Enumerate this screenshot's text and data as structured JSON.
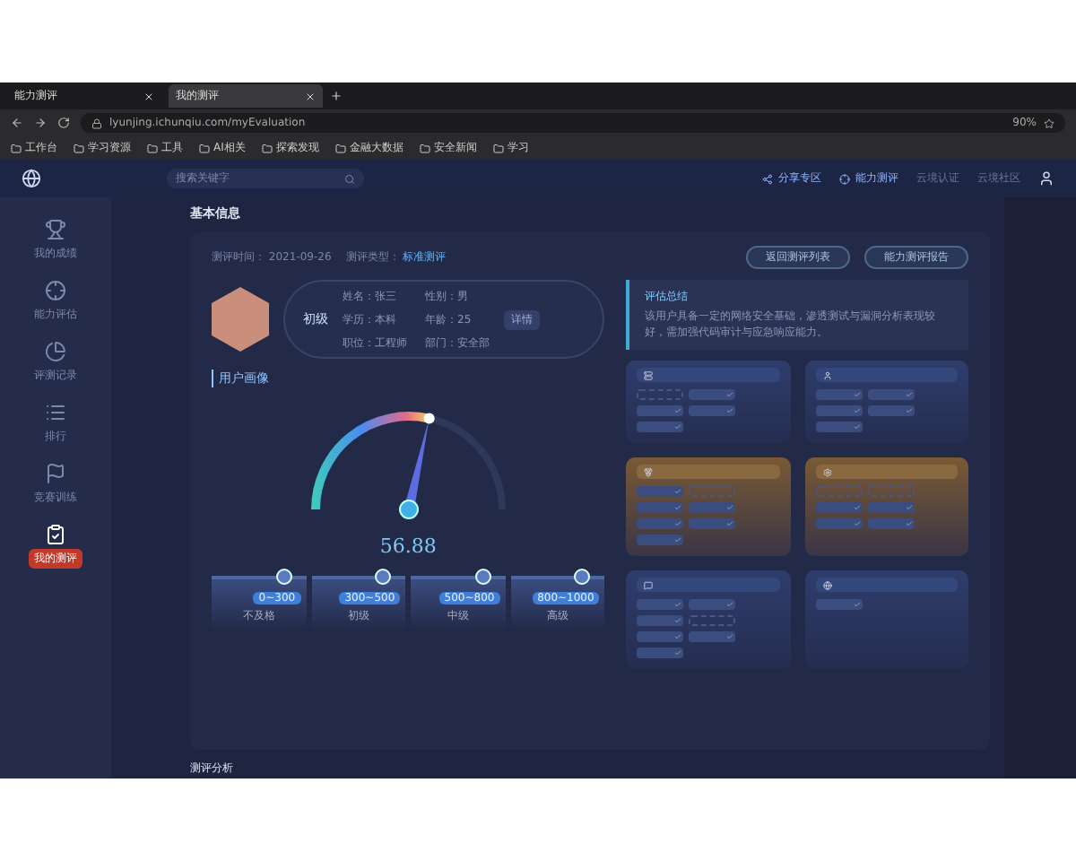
{
  "browser": {
    "tabs": [
      {
        "label": "能力测评",
        "selected": false
      },
      {
        "label": "我的测评",
        "selected": true
      }
    ],
    "url": "lyunjing.ichunqiu.com/myEvaluation",
    "zoom": "90%",
    "bookmarks": [
      "工作台",
      "学习资源",
      "工具",
      "AI相关",
      "探索发现",
      "金融大数据",
      "安全新闻",
      "学习"
    ]
  },
  "header": {
    "search": {
      "placeholder": "搜索关键字"
    },
    "actions": [
      "分享专区",
      "能力测评"
    ],
    "links": [
      "云境认证",
      "云境社区"
    ]
  },
  "sidebar": {
    "items": [
      {
        "label": "我的成绩",
        "selected": false
      },
      {
        "label": "能力评估",
        "selected": false
      },
      {
        "label": "评测记录",
        "selected": false
      },
      {
        "label": "排行",
        "selected": false
      },
      {
        "label": "竞赛训练",
        "selected": false
      },
      {
        "label": "我的测评",
        "selected": true
      }
    ]
  },
  "page": {
    "title": "基本信息",
    "date_label": "测评时间：",
    "date": "2021-09-26",
    "type_label": "测评类型：",
    "type": "标准测评",
    "buttons": [
      "返回测评列表",
      "能力测评报告"
    ],
    "profile": {
      "level": "初级",
      "fields": [
        "姓名：张三",
        "性别：男",
        "学历：本科",
        "年龄：25",
        "职位：工程师",
        "部门：安全部"
      ],
      "tag": "详情"
    },
    "summary": {
      "title": "评估总结",
      "text": "该用户具备一定的网络安全基础，渗透测试与漏洞分析表现较好，需加强代码审计与应急响应能力。"
    },
    "portrait": {
      "title": "用户画像",
      "score": "56.88",
      "level": 0.57,
      "bands": [
        {
          "range": "0~300",
          "label": "不及格"
        },
        {
          "range": "300~500",
          "label": "初级"
        },
        {
          "range": "500~800",
          "label": "中级"
        },
        {
          "range": "800~1000",
          "label": "高级"
        }
      ]
    },
    "cards": [
      {
        "kind": "blue",
        "chips": [
          {
            "checked": false
          },
          {
            "checked": true
          },
          {
            "checked": true
          },
          {
            "checked": true
          },
          {
            "checked": true
          }
        ]
      },
      {
        "kind": "blue",
        "chips": [
          {
            "checked": true
          },
          {
            "checked": true
          },
          {
            "checked": true
          },
          {
            "checked": true
          },
          {
            "checked": true
          }
        ]
      },
      {
        "kind": "orange",
        "chips": [
          {
            "checked": true
          },
          {
            "checked": false
          },
          {
            "checked": true
          },
          {
            "checked": true
          },
          {
            "checked": true
          },
          {
            "checked": true
          },
          {
            "checked": true
          }
        ]
      },
      {
        "kind": "orange",
        "chips": [
          {
            "checked": false
          },
          {
            "checked": false
          },
          {
            "checked": true
          },
          {
            "checked": true
          },
          {
            "checked": true
          },
          {
            "checked": true
          }
        ]
      },
      {
        "kind": "blue",
        "chips": [
          {
            "checked": true
          },
          {
            "checked": true
          },
          {
            "checked": true
          },
          {
            "checked": false
          },
          {
            "checked": true
          },
          {
            "checked": true
          },
          {
            "checked": true
          }
        ]
      },
      {
        "kind": "blue",
        "chips": [
          {
            "checked": true
          }
        ]
      }
    ],
    "analysis_title": "测评分析"
  }
}
